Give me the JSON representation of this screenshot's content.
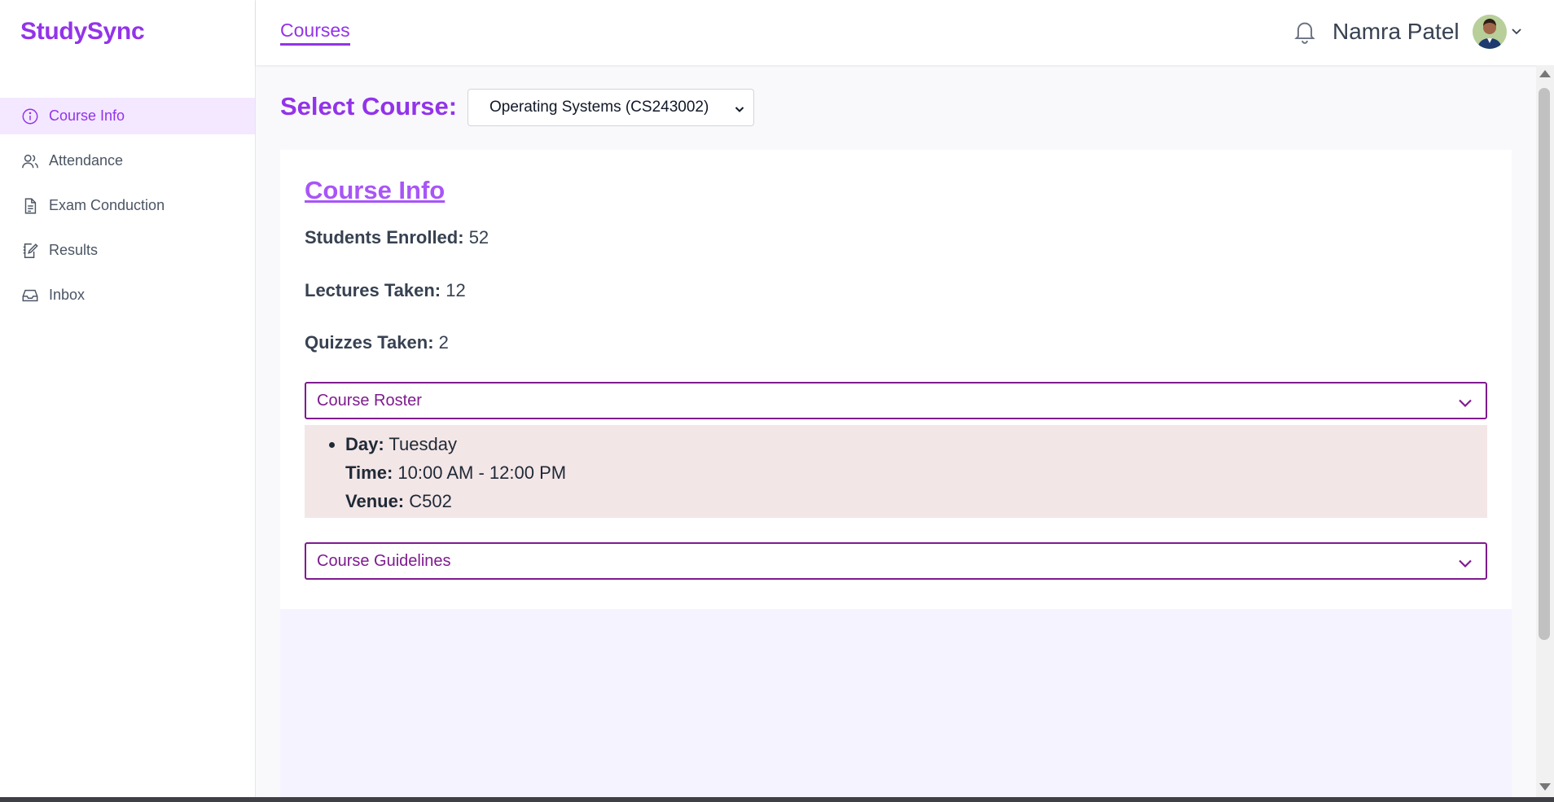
{
  "brand": "StudySync",
  "sidebar": {
    "items": [
      {
        "label": "Course Info",
        "icon": "info-circle-icon",
        "active": true
      },
      {
        "label": "Attendance",
        "icon": "users-icon",
        "active": false
      },
      {
        "label": "Exam Conduction",
        "icon": "document-icon",
        "active": false
      },
      {
        "label": "Results",
        "icon": "edit-notebook-icon",
        "active": false
      },
      {
        "label": "Inbox",
        "icon": "inbox-icon",
        "active": false
      }
    ]
  },
  "header": {
    "tab_label": "Courses",
    "user_name": "Namra Patel"
  },
  "select_course": {
    "label": "Select Course:",
    "selected": "Operating Systems (CS243002)"
  },
  "course_info": {
    "title": "Course Info",
    "stats": [
      {
        "label": "Students Enrolled:",
        "value": "52"
      },
      {
        "label": "Lectures Taken:",
        "value": "12"
      },
      {
        "label": "Quizzes Taken:",
        "value": "2"
      }
    ]
  },
  "roster": {
    "label": "Course Roster",
    "day_label": "Day:",
    "day": "Tuesday",
    "time_label": "Time:",
    "time": "10:00 AM - 12:00 PM",
    "venue_label": "Venue:",
    "venue": "C502"
  },
  "guidelines": {
    "label": "Course Guidelines"
  },
  "colors": {
    "accent": "#9333ea",
    "accordion_border": "#7e1b8f",
    "roster_bg": "#f3e6e6"
  }
}
